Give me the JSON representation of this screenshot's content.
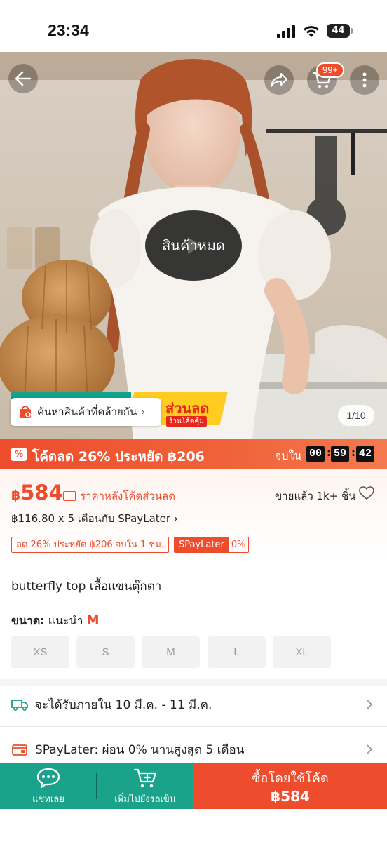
{
  "status_bar": {
    "time": "23:34",
    "battery": "44"
  },
  "hero": {
    "cart_badge": "99+",
    "sold_out_label": "สินค้าหมด",
    "search_similar_label": "ค้นหาสินค้าที่คล้ายกัน",
    "banner_text": "ส่วนลด",
    "banner_sub": "ร้านโค้ดคุ้ม",
    "image_counter": "1/10",
    "icons": [
      "back-arrow-icon",
      "share-icon",
      "cart-icon",
      "more-icon",
      "play-icon",
      "shopping-bag-icon"
    ]
  },
  "flash_promo": {
    "text": "โค้ดลด 26% ประหยัด ฿206",
    "ends_in_label": "จบใน",
    "hours": "00",
    "minutes": "59",
    "seconds": "42"
  },
  "price": {
    "currency": "฿",
    "value": "584",
    "after_code_label": "ราคาหลังโค้ดส่วนลด",
    "sold_label": "ขายแล้ว 1k+ ชิ้น",
    "installment": "฿116.80 x 5 เดือนกับ SPayLater",
    "coupon_discount": "ลด 26% ประหยัด ฿206 จบใน 1 ชม.",
    "coupon_spaylater": "SPayLater",
    "coupon_spaylater_rate": "0%"
  },
  "product": {
    "title": "butterfly top เสื้อแขนตุ๊กตา",
    "size_label": "ขนาด:",
    "size_recommend_prefix": "แนะนำ",
    "size_recommend": "M",
    "sizes": [
      "XS",
      "S",
      "M",
      "L",
      "XL"
    ]
  },
  "info_rows": {
    "delivery": "จะได้รับภายใน 10 มี.ค. - 11 มี.ค.",
    "spaylater": "SPayLater: ผ่อน 0% นานสูงสุด   5 เดือน"
  },
  "bottom_bar": {
    "chat_label": "แชทเลย",
    "add_cart_label": "เพิ่มไปยังรถเข็น",
    "buy_label": "ซื้อโดยใช้โค้ด",
    "buy_price": "฿584"
  },
  "colors": {
    "accent": "#ee4d2d",
    "teal": "#1aa38a"
  }
}
